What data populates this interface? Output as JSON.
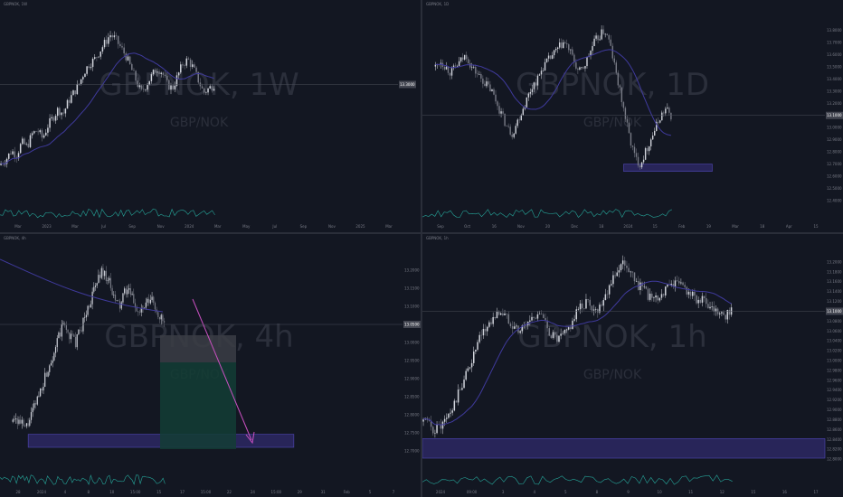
{
  "colors": {
    "background": "#131722",
    "candle_up": "#d1d4dc",
    "candle_down": "#787b86",
    "ma_line": "#3f3a9c",
    "oscillator": "#26a69a",
    "zone_fill": "#3a3287",
    "target_fill": "#133d35",
    "risk_fill": "#3b3d45",
    "arrow": "#c850c0",
    "watermark": "#2b2f3b",
    "axis_text": "#787b86",
    "price_tag": "#434651"
  },
  "chart_data": [
    {
      "type": "candlestick",
      "symbol": "GBPNOK",
      "interval": "1W",
      "watermark": "GBPNOK, 1W",
      "subtitle": "GBP/NOK",
      "x_tick_labels": [
        "Mar",
        "2023",
        "Mar",
        "Jul",
        "Sep",
        "Nov",
        "2024",
        "Mar",
        "May",
        "Jul",
        "Sep",
        "Nov",
        "2025",
        "Mar"
      ],
      "last_price": "13.3000",
      "close_series": [
        12.35,
        12.4,
        12.5,
        12.45,
        12.6,
        12.55,
        12.7,
        12.75,
        12.65,
        12.8,
        12.9,
        13.0,
        12.95,
        13.1,
        13.2,
        13.3,
        13.45,
        13.55,
        13.6,
        13.7,
        13.8,
        13.9,
        13.85,
        13.75,
        13.65,
        13.5,
        13.35,
        13.2,
        13.3,
        13.4,
        13.5,
        13.45,
        13.3,
        13.25,
        13.4,
        13.55,
        13.6,
        13.5,
        13.35,
        13.2,
        13.25,
        13.3
      ]
    },
    {
      "type": "candlestick",
      "symbol": "GBPNOK",
      "interval": "1D",
      "watermark": "GBPNOK, 1D",
      "subtitle": "GBP/NOK",
      "y_tick_labels": [
        "13.8000",
        "13.7000",
        "13.6000",
        "13.5000",
        "13.4000",
        "13.3000",
        "13.2000",
        "13.1000",
        "13.0000",
        "12.9000",
        "12.8000",
        "12.7000",
        "12.6000",
        "12.5000",
        "12.4000"
      ],
      "x_tick_labels": [
        "Sep",
        "Oct",
        "16",
        "Nov",
        "20",
        "Dec",
        "18",
        "2024",
        "15",
        "Feb",
        "19",
        "Mar",
        "18",
        "Apr",
        "15"
      ],
      "last_price": "13.1000",
      "close_series": [
        13.5,
        13.55,
        13.5,
        13.45,
        13.5,
        13.55,
        13.6,
        13.5,
        13.45,
        13.4,
        13.35,
        13.3,
        13.2,
        13.1,
        13.0,
        12.95,
        13.05,
        13.15,
        13.25,
        13.35,
        13.4,
        13.5,
        13.55,
        13.6,
        13.65,
        13.7,
        13.65,
        13.55,
        13.45,
        13.5,
        13.6,
        13.7,
        13.75,
        13.8,
        13.7,
        13.5,
        13.3,
        13.1,
        12.9,
        12.75,
        12.7,
        12.8,
        12.9,
        13.0,
        13.1,
        13.15,
        13.1
      ]
    },
    {
      "type": "candlestick",
      "symbol": "GBPNOK",
      "interval": "4h",
      "watermark": "GBPNOK, 4h",
      "subtitle": "GBP/NOK",
      "y_tick_labels": [
        "13.2000",
        "13.1500",
        "13.1000",
        "13.0500",
        "13.0000",
        "12.9500",
        "12.9000",
        "12.8500",
        "12.8000",
        "12.7500",
        "12.7000"
      ],
      "x_tick_labels": [
        "28",
        "2024",
        "4",
        "8",
        "10",
        "15:00",
        "15",
        "17",
        "15:00",
        "22",
        "24",
        "15:00",
        "29",
        "31",
        "Feb",
        "5",
        "7"
      ],
      "last_price": "13.0500",
      "close_series": [
        12.8,
        12.78,
        12.76,
        12.8,
        12.85,
        12.9,
        12.95,
        13.0,
        13.05,
        13.02,
        13.0,
        13.05,
        13.1,
        13.15,
        13.2,
        13.18,
        13.12,
        13.1,
        13.15,
        13.12,
        13.08,
        13.1,
        13.12,
        13.08,
        13.05
      ]
    },
    {
      "type": "candlestick",
      "symbol": "GBPNOK",
      "interval": "1h",
      "watermark": "GBPNOK, 1h",
      "subtitle": "GBP/NOK",
      "y_tick_labels": [
        "13.2000",
        "13.1800",
        "13.1600",
        "13.1400",
        "13.1200",
        "13.1000",
        "13.0800",
        "13.0600",
        "13.0400",
        "13.0200",
        "13.0000",
        "12.9800",
        "12.9600",
        "12.9400",
        "12.9200",
        "12.9000",
        "12.8800",
        "12.8600",
        "12.8400",
        "12.8200",
        "12.8000"
      ],
      "x_tick_labels": [
        "2024",
        "09:00",
        "3",
        "4",
        "5",
        "8",
        "9",
        "10",
        "11",
        "12",
        "15",
        "16",
        "17"
      ],
      "last_price": "13.1000",
      "close_series": [
        12.88,
        12.86,
        12.87,
        12.9,
        12.95,
        13.0,
        13.05,
        13.08,
        13.1,
        13.08,
        13.06,
        13.08,
        13.1,
        13.06,
        13.04,
        13.06,
        13.1,
        13.12,
        13.1,
        13.14,
        13.18,
        13.2,
        13.16,
        13.14,
        13.12,
        13.14,
        13.16,
        13.15,
        13.13,
        13.12,
        13.1,
        13.09,
        13.1
      ]
    }
  ]
}
